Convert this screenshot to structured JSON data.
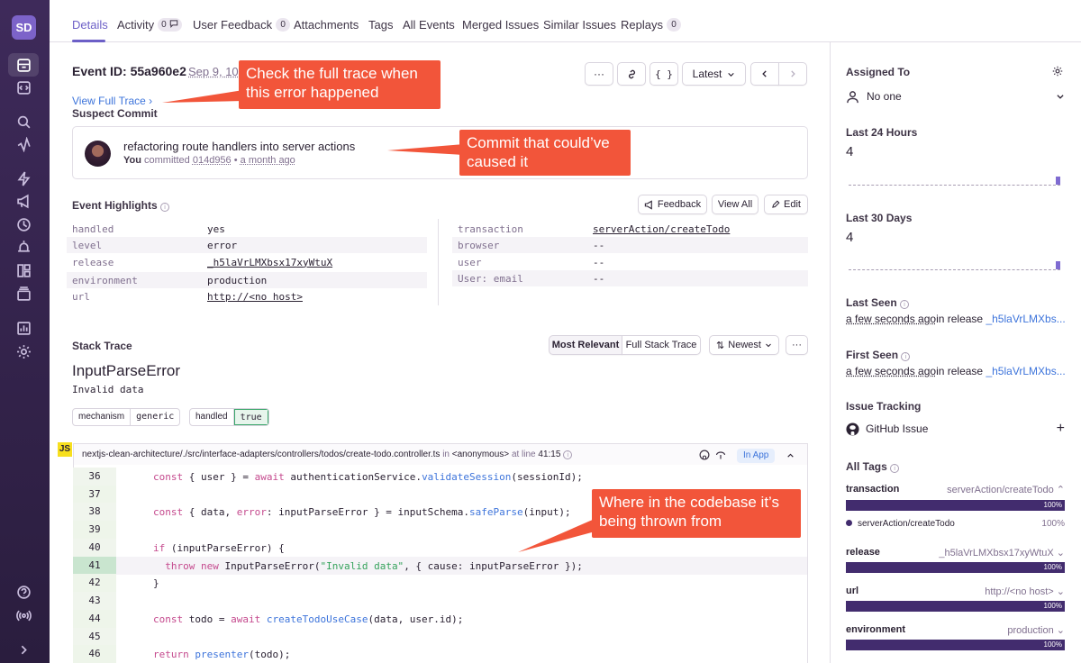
{
  "sidebar": {
    "avatar": "SD"
  },
  "tabs": [
    {
      "label": "Details"
    },
    {
      "label": "Activity",
      "badge": "0"
    },
    {
      "label": "User Feedback",
      "badge": "0"
    },
    {
      "label": "Attachments"
    },
    {
      "label": "Tags"
    },
    {
      "label": "All Events"
    },
    {
      "label": "Merged Issues"
    },
    {
      "label": "Similar Issues"
    },
    {
      "label": "Replays",
      "badge": "0"
    }
  ],
  "event": {
    "id_label": "Event ID:",
    "id": "55a960e2",
    "date": "Sep 9, 10",
    "view_full_trace": "View Full Trace",
    "toolbar": {
      "more": "···",
      "latest": "Latest"
    }
  },
  "suspect_commit": {
    "title": "Suspect Commit",
    "message": "refactoring route handlers into server actions",
    "author": "You",
    "committed": "committed",
    "sha": "014d956",
    "when": "a month ago"
  },
  "highlights": {
    "title": "Event Highlights",
    "feedback": "Feedback",
    "view_all": "View All",
    "edit": "Edit",
    "left": [
      {
        "key": "handled",
        "value": "yes",
        "link": false
      },
      {
        "key": "level",
        "value": "error",
        "link": false
      },
      {
        "key": "release",
        "value": "_h5laVrLMXbsx17xyWtuX",
        "link": true
      },
      {
        "key": "environment",
        "value": "production",
        "link": false
      },
      {
        "key": "url",
        "value": "http://<no host>",
        "link": true
      }
    ],
    "right": [
      {
        "key": "transaction",
        "value": "serverAction/createTodo",
        "link": true
      },
      {
        "key": "browser",
        "value": "--",
        "link": false
      },
      {
        "key": "user",
        "value": "--",
        "link": false
      },
      {
        "key": "User: email",
        "value": "--",
        "link": false
      }
    ]
  },
  "stack": {
    "title": "Stack Trace",
    "most_relevant": "Most Relevant",
    "full_stack": "Full Stack Trace",
    "newest": "Newest",
    "error_name": "InputParseError",
    "error_message": "Invalid data",
    "mech_key": "mechanism",
    "mech_val": "generic",
    "handled_key": "handled",
    "handled_val": "true",
    "lang": "JS",
    "frame_path": "nextjs-clean-architecture/./src/interface-adapters/controllers/todos/create-todo.controller.ts",
    "frame_in": "in",
    "frame_fn": "<anonymous>",
    "frame_at": "at line",
    "frame_line": "41:15",
    "in_app": "In App"
  },
  "annotations": {
    "trace": "Check the full trace when this error happened",
    "commit": "Commit that could’ve caused it",
    "code": "Where in the codebase it’s being thrown from"
  },
  "right": {
    "assigned_to": "Assigned To",
    "assignee": "No one",
    "last24_label": "Last 24 Hours",
    "last24": "4",
    "last30_label": "Last 30 Days",
    "last30": "4",
    "last_seen_label": "Last Seen",
    "last_seen_time": "a few seconds ago",
    "in_release": "in release",
    "last_seen_release": "_h5laVrLMXbs...",
    "first_seen_label": "First Seen",
    "first_seen_time": "a few seconds ago",
    "first_seen_release": "_h5laVrLMXbs...",
    "issue_tracking": "Issue Tracking",
    "github_issue": "GitHub Issue",
    "all_tags": "All Tags",
    "tags": [
      {
        "key": "transaction",
        "value": "serverAction/createTodo",
        "pct": "100%"
      },
      {
        "key": "release",
        "value": "_h5laVrLMXbsx17xyWtuX",
        "pct": "100%"
      },
      {
        "key": "url",
        "value": "http://<no host>",
        "pct": "100%"
      },
      {
        "key": "environment",
        "value": "production",
        "pct": "100%"
      }
    ],
    "tag_detail": {
      "value": "serverAction/createTodo",
      "pct": "100%"
    }
  },
  "colors": {
    "accent": "#6c5fc7",
    "annotation": "#f2553a",
    "tag_bar": "#422c6e",
    "sidebar": "#2f2142"
  }
}
